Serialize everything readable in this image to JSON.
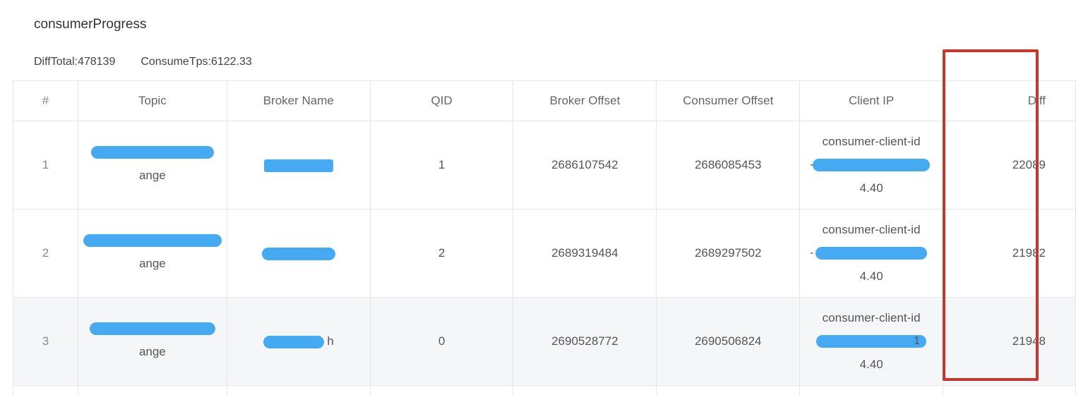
{
  "page": {
    "title": "consumerProgress",
    "diff_total_label": "DiffTotal:",
    "diff_total": "478139",
    "consume_tps_label": "ConsumeTps:",
    "consume_tps": "6122.33"
  },
  "table": {
    "headers": [
      "#",
      "Topic",
      "Broker Name",
      "QID",
      "Broker Offset",
      "Consumer Offset",
      "Client IP",
      "Diff"
    ],
    "rows": [
      {
        "index": "1",
        "topic_tail": "ange",
        "broker_name": "",
        "qid": "1",
        "broker_offset": "2686107542",
        "consumer_offset": "2686085453",
        "client_ip_line1": "consumer-client-id",
        "client_ip_line2_prefix": "-",
        "client_ip_line3": "4.40",
        "diff": "22089"
      },
      {
        "index": "2",
        "topic_tail": "ange",
        "broker_name": "",
        "qid": "2",
        "broker_offset": "2689319484",
        "consumer_offset": "2689297502",
        "client_ip_line1": "consumer-client-id",
        "client_ip_line2_prefix": "-",
        "client_ip_line3": "4.40",
        "diff": "21982"
      },
      {
        "index": "3",
        "topic_tail": "ange",
        "broker_name": "h",
        "qid": "0",
        "broker_offset": "2690528772",
        "consumer_offset": "2690506824",
        "client_ip_line1": "consumer-client-id",
        "client_ip_line2_prefix": "1",
        "client_ip_line3": "4.40",
        "diff": "21948"
      }
    ]
  },
  "colors": {
    "redaction": "#45aaf2",
    "highlight_border": "#c9372c",
    "row_highlight": "#f4f6f8"
  }
}
